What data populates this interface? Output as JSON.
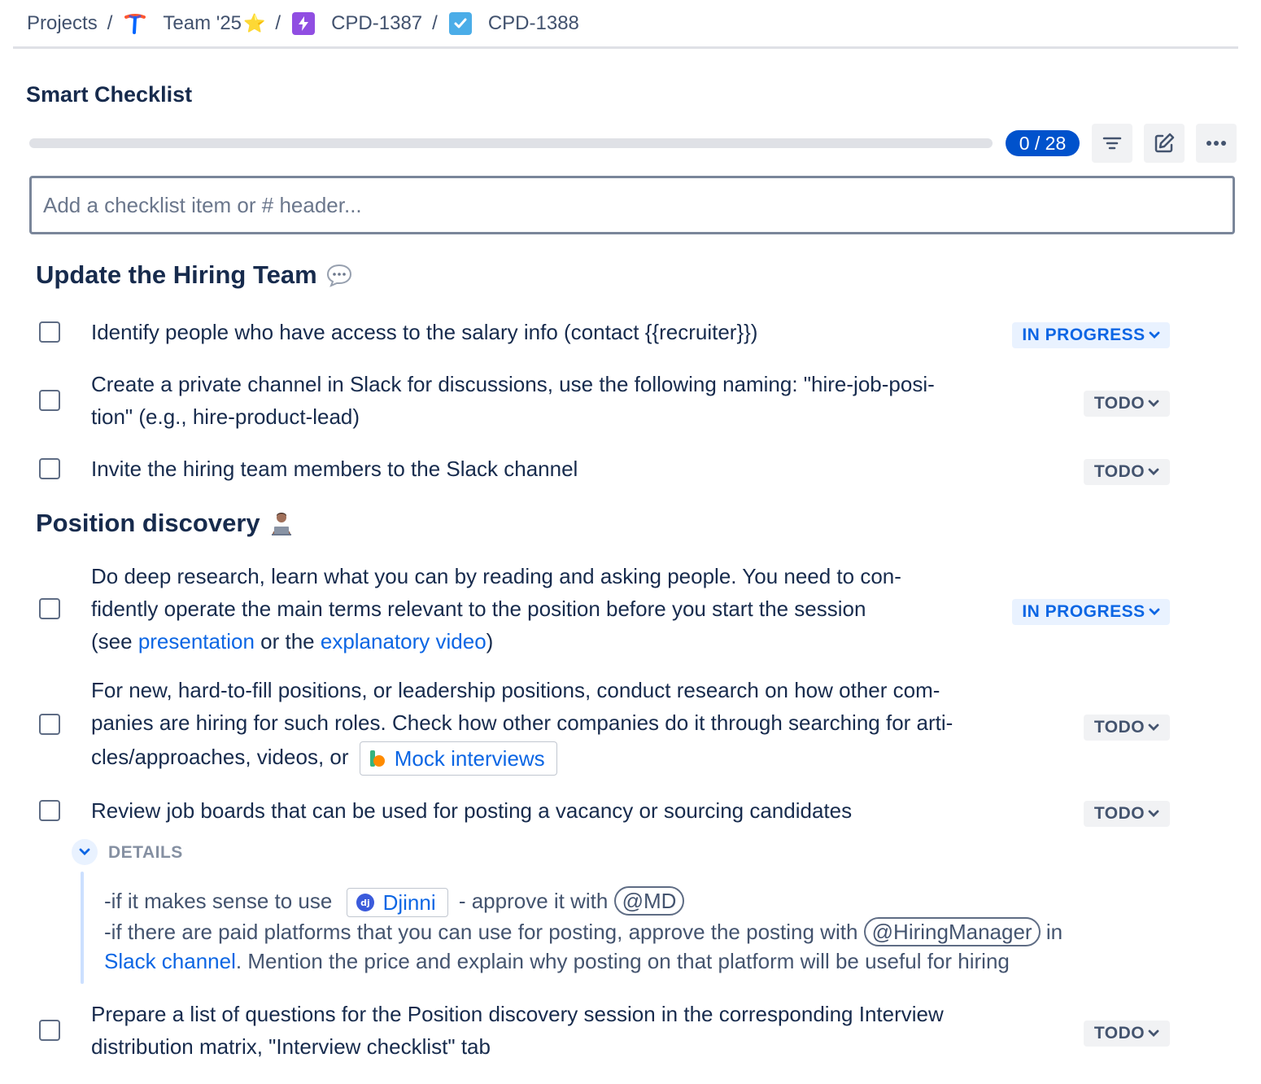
{
  "breadcrumb": {
    "projects": "Projects",
    "team": "Team '25",
    "team_star": "⭐",
    "parent": "CPD-1387",
    "current": "CPD-1388",
    "separator": "/"
  },
  "checklist": {
    "title": "Smart Checklist",
    "progress_count": "0 / 28",
    "progress_fraction": 0,
    "add_placeholder": "Add a checklist item or # header..."
  },
  "sections": [
    {
      "header": "Update the Hiring Team",
      "header_icon": "speech-bubble-icon",
      "items": [
        {
          "text": "Identify people who have access to the salary info (contact {{recruiter}})",
          "status": "IN PROGRESS"
        },
        {
          "line1": "Create a private channel in Slack for discussions, use the following naming: \"hire-job-posi-",
          "line2": "tion\" (e.g., hire-product-lead)",
          "status": "TODO"
        },
        {
          "text": "Invite the hiring team members to the Slack channel",
          "status": "TODO"
        }
      ]
    },
    {
      "header": "Position discovery",
      "header_icon": "person-laptop-icon",
      "items": [
        {
          "line1": "Do deep research, learn what you can by reading and asking people. You need to con-",
          "line2": "fidently operate the main terms relevant to the position before you start the session",
          "line3_prefix": "(see ",
          "link1": "presentation",
          "line3_mid": " or the ",
          "link2": "explanatory video",
          "line3_suffix": ")",
          "status": "IN PROGRESS"
        },
        {
          "line1": "For new, hard-to-fill positions, or leadership positions, conduct research on how other com-",
          "line2": "panies are hiring for such roles. Check how other companies do it through searching for arti-",
          "line3": "cles/approaches, videos, or",
          "smart_link": "Mock interviews",
          "status": "TODO"
        },
        {
          "text": "Review job boards that can be used for posting a vacancy or sourcing candidates",
          "status": "TODO",
          "details": {
            "label": "DETAILS",
            "line1_prefix": "-if it makes sense to use",
            "smart_link": "Djinni",
            "line1_mid": "- approve it with",
            "mention1": "@MD",
            "line2_prefix": "-if there are paid platforms that you can use for posting, approve the posting with",
            "mention2": "@HiringManager",
            "line2_suffix": "in",
            "line3_link": "Slack channel",
            "line3_suffix": ". Mention the price and explain why posting on that platform will be useful for hiring"
          }
        },
        {
          "line1": "Prepare a list of questions for the Position discovery session in the corresponding Interview",
          "line2": "distribution matrix, \"Interview checklist\" tab",
          "status": "TODO"
        }
      ]
    }
  ]
}
